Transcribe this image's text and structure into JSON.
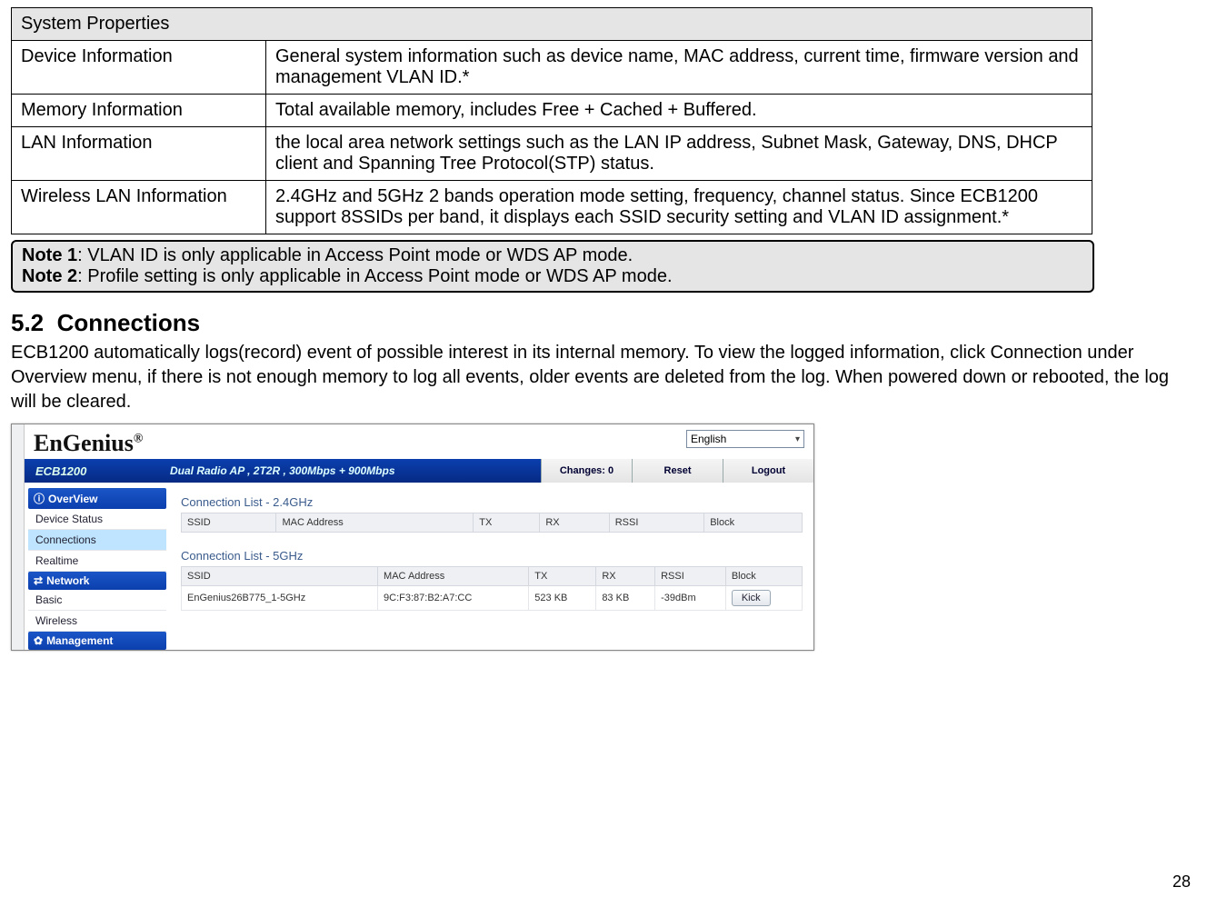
{
  "props_table": {
    "header": "System Properties",
    "rows": [
      {
        "label": "Device Information",
        "desc": "General system information such as device name, MAC address, current time, firmware version and management VLAN ID.*"
      },
      {
        "label": "Memory Information",
        "desc": "Total available memory, includes Free + Cached + Buffered."
      },
      {
        "label": "LAN Information",
        "desc": "the local area network settings such as the LAN IP address, Subnet Mask, Gateway, DNS, DHCP client and Spanning Tree Protocol(STP) status."
      },
      {
        "label": "Wireless LAN Information",
        "desc": "2.4GHz and 5GHz 2 bands operation mode setting, frequency, channel status. Since ECB1200 support 8SSIDs per band, it displays each SSID security setting and VLAN ID assignment.*"
      }
    ]
  },
  "notes": {
    "n1_label": "Note 1",
    "n1_text": ": VLAN ID is only applicable in Access Point mode or WDS AP mode.",
    "n2_label": "Note 2",
    "n2_text": ": Profile setting is only applicable in Access Point mode or WDS AP mode."
  },
  "section": {
    "number": "5.2",
    "title": "Connections",
    "body": "ECB1200 automatically logs(record) event of possible interest in its internal memory. To view the logged information, click Connection under Overview menu, if there is not enough memory to log all events, older events are deleted from the log. When powered down or rebooted, the log will be cleared."
  },
  "screenshot": {
    "logo": "EnGenius",
    "reg": "®",
    "language": "English",
    "model": "ECB1200",
    "tagline": "Dual Radio AP , 2T2R , 300Mbps + 900Mbps",
    "changes": "Changes: 0",
    "reset": "Reset",
    "logout": "Logout",
    "side": {
      "overview_hdr": "OverView",
      "overview_icon": "ⓘ",
      "items_overview": [
        "Device Status",
        "Connections",
        "Realtime"
      ],
      "network_hdr": "Network",
      "network_icon": "⇄",
      "items_network": [
        "Basic",
        "Wireless"
      ],
      "management_hdr": "Management",
      "management_icon": "✿"
    },
    "main": {
      "list24_title": "Connection List - 2.4GHz",
      "list5_title": "Connection List - 5GHz",
      "cols": [
        "SSID",
        "MAC Address",
        "TX",
        "RX",
        "RSSI",
        "Block"
      ],
      "row5": {
        "ssid": "EnGenius26B775_1-5GHz",
        "mac": "9C:F3:87:B2:A7:CC",
        "tx": "523 KB",
        "rx": "83 KB",
        "rssi": "-39dBm",
        "block": "Kick"
      }
    }
  },
  "page_number": "28"
}
